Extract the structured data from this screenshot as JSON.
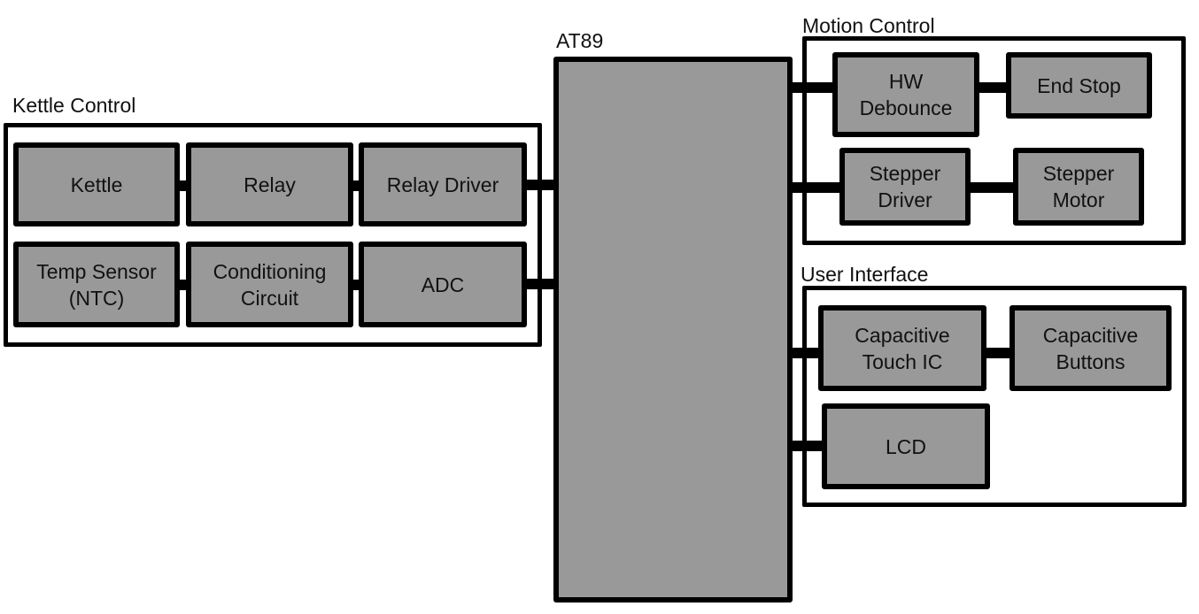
{
  "mcu": {
    "label": "AT89"
  },
  "groups": {
    "kettle_control": {
      "title": "Kettle Control",
      "blocks": {
        "kettle": "Kettle",
        "relay": "Relay",
        "relay_driver": "Relay Driver",
        "temp_sensor": "Temp Sensor\n(NTC)",
        "conditioning": "Conditioning\nCircuit",
        "adc": "ADC"
      }
    },
    "motion_control": {
      "title": "Motion Control",
      "blocks": {
        "hw_debounce": "HW\nDebounce",
        "end_stop": "End Stop",
        "stepper_driver": "Stepper\nDriver",
        "stepper_motor": "Stepper\nMotor"
      }
    },
    "user_interface": {
      "title": "User Interface",
      "blocks": {
        "touch_ic": "Capacitive\nTouch IC",
        "cap_buttons": "Capacitive\nButtons",
        "lcd": "LCD"
      }
    }
  },
  "colors": {
    "block_fill": "#999999",
    "outline": "#000000",
    "background": "#ffffff"
  }
}
